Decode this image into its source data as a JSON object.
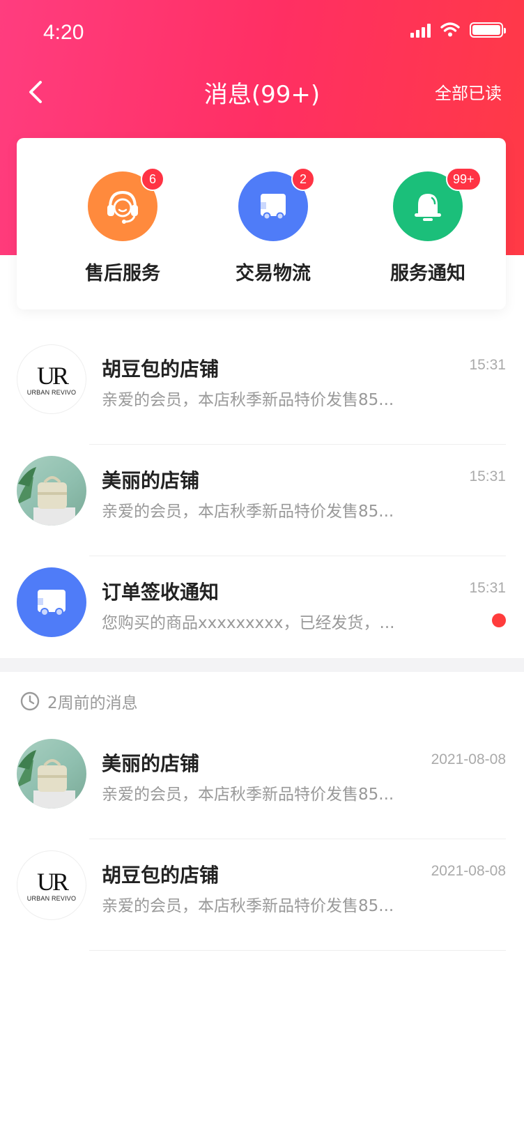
{
  "status_bar": {
    "time": "4:20"
  },
  "nav": {
    "title": "消息(99+)",
    "action": "全部已读"
  },
  "categories": [
    {
      "label": "售后服务",
      "badge": "6",
      "color": "#ff8a3d",
      "icon": "headset-icon"
    },
    {
      "label": "交易物流",
      "badge": "2",
      "color": "#4f7cf8",
      "icon": "truck-icon"
    },
    {
      "label": "服务通知",
      "badge": "99+",
      "color": "#1bbf7a",
      "icon": "bell-icon"
    }
  ],
  "messages": [
    {
      "title": "胡豆包的店铺",
      "time": "15:31",
      "preview": "亲爱的会员，本店秋季新品特价发售85...",
      "avatar": "ur-logo",
      "unread": false
    },
    {
      "title": "美丽的店铺",
      "time": "15:31",
      "preview": "亲爱的会员，本店秋季新品特价发售85...",
      "avatar": "photo",
      "unread": false
    },
    {
      "title": "订单签收通知",
      "time": "15:31",
      "preview": "您购买的商品xxxxxxxxx，已经发货，...",
      "avatar": "truck",
      "unread": true
    }
  ],
  "older_section": {
    "title": "2周前的消息"
  },
  "older_messages": [
    {
      "title": "美丽的店铺",
      "time": "2021-08-08",
      "preview": "亲爱的会员，本店秋季新品特价发售85...",
      "avatar": "photo"
    },
    {
      "title": "胡豆包的店铺",
      "time": "2021-08-08",
      "preview": "亲爱的会员，本店秋季新品特价发售85...",
      "avatar": "ur-logo"
    }
  ],
  "brand_logo": {
    "mark": "UR",
    "text": "URBAN REVIVO"
  },
  "colors": {
    "header_start": "#ff3d7f",
    "header_end": "#ff3a45",
    "badge": "#ff3344",
    "unread_dot": "#ff3c3c"
  }
}
